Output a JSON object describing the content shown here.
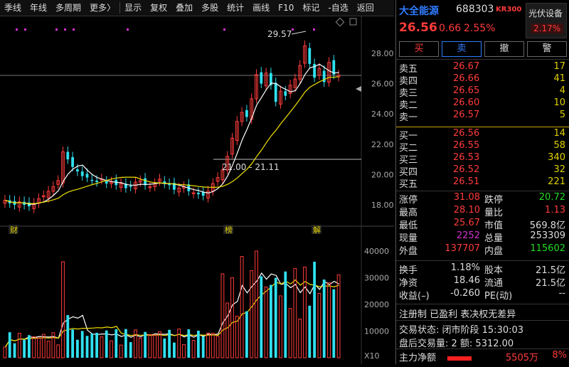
{
  "toolbar": {
    "items": [
      "季线",
      "年线",
      "多周期",
      "更多"
    ],
    "more_arrow": "〉",
    "tools": [
      "显示",
      "复权",
      "叠加",
      "多股",
      "统计",
      "画线",
      "F10",
      "标记",
      "-自选",
      "返回"
    ]
  },
  "chart": {
    "y_ticks": [
      "28.00",
      "26.00",
      "24.00",
      "22.00",
      "20.00",
      "18.00"
    ],
    "vol_ticks": [
      "40000",
      "30000",
      "20000",
      "10000"
    ],
    "vol_unit": "X10",
    "high_label": "29.57",
    "range_label": "21.00 - 21.11",
    "markers": [
      "财",
      "榜",
      "解"
    ]
  },
  "header": {
    "name": "大全能源",
    "code": "688303",
    "badge": "KR300",
    "price": "26.56",
    "change": "0.66",
    "change_pct": "2.55%",
    "sector": "光伏设备",
    "sector_pct": "2.17%"
  },
  "actions": {
    "buy": "买",
    "sell": "卖",
    "cancel": "撤",
    "alert": "警"
  },
  "sell_orders": [
    {
      "label": "卖五",
      "price": "26.67",
      "vol": "17"
    },
    {
      "label": "卖四",
      "price": "26.66",
      "vol": "41"
    },
    {
      "label": "卖三",
      "price": "26.65",
      "vol": "4"
    },
    {
      "label": "卖二",
      "price": "26.60",
      "vol": "10"
    },
    {
      "label": "卖一",
      "price": "26.57",
      "vol": "5"
    }
  ],
  "buy_orders": [
    {
      "label": "买一",
      "price": "26.56",
      "vol": "14"
    },
    {
      "label": "买二",
      "price": "26.55",
      "vol": "58"
    },
    {
      "label": "买三",
      "price": "26.53",
      "vol": "340"
    },
    {
      "label": "买四",
      "price": "26.52",
      "vol": "32"
    },
    {
      "label": "买五",
      "price": "26.51",
      "vol": "221"
    }
  ],
  "stats1": [
    {
      "l1": "涨停",
      "v1": "31.08",
      "c1": "red",
      "l2": "跌停",
      "v2": "20.72",
      "c2": "green"
    },
    {
      "l1": "最高",
      "v1": "28.10",
      "c1": "red",
      "l2": "量比",
      "v2": "1.13",
      "c2": "red"
    },
    {
      "l1": "最低",
      "v1": "25.67",
      "c1": "red",
      "l2": "市值",
      "v2": "569.8亿",
      "c2": "white"
    },
    {
      "l1": "现量",
      "v1": "2252",
      "c1": "mag",
      "l2": "总量",
      "v2": "253309",
      "c2": "white"
    },
    {
      "l1": "外盘",
      "v1": "137707",
      "c1": "red",
      "l2": "内盘",
      "v2": "115602",
      "c2": "green"
    }
  ],
  "stats2": [
    {
      "l1": "换手",
      "v1": "1.18%",
      "c1": "white",
      "l2": "股本",
      "v2": "21.5亿",
      "c2": "white"
    },
    {
      "l1": "净资",
      "v1": "18.46",
      "c1": "white",
      "l2": "流通",
      "v2": "21.5亿",
      "c2": "white"
    },
    {
      "l1": "收益(–)",
      "v1": "-0.260",
      "c1": "white",
      "l2": "PE(动)",
      "v2": "--",
      "c2": "white"
    }
  ],
  "tags": "注册制 已盈利 表决权无差异",
  "trade_status": "交易状态: 闭市阶段 15:30:03",
  "after_hours": "盘后交易量: 2  额: 5312.00",
  "main_flow": {
    "label": "主力净额",
    "value": "5505万",
    "pct": "8%"
  }
}
